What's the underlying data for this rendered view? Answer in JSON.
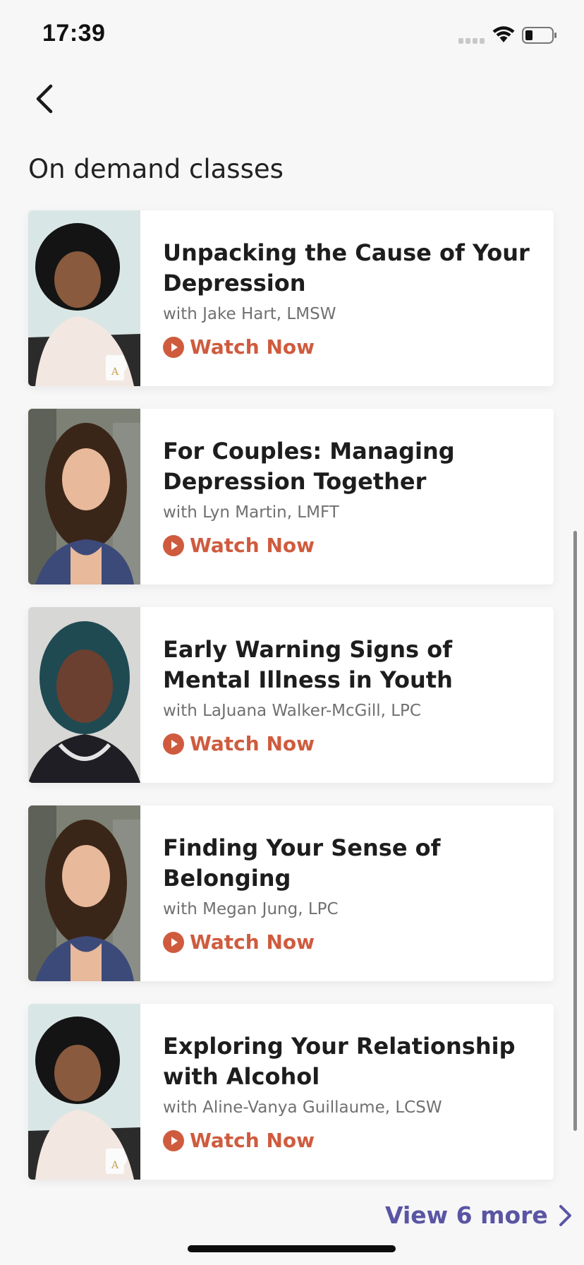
{
  "status_bar": {
    "time": "17:39"
  },
  "header": {
    "section_title": "On demand classes"
  },
  "classes": [
    {
      "title": "Unpacking the Cause of Your Depression",
      "instructor": "with Jake Hart, LMSW",
      "action": "Watch Now",
      "photo": "woman-curly-hair-with-mug"
    },
    {
      "title": "For Couples: Managing Depression Together",
      "instructor": "with Lyn Martin, LMFT",
      "action": "Watch Now",
      "photo": "woman-long-brown-hair"
    },
    {
      "title": "Early Warning Signs of Mental Illness in Youth",
      "instructor": "with LaJuana Walker-McGill, LPC",
      "action": "Watch Now",
      "photo": "woman-teal-bob-hair"
    },
    {
      "title": "Finding Your Sense of Belonging",
      "instructor": "with Megan Jung, LPC",
      "action": "Watch Now",
      "photo": "woman-long-brown-hair"
    },
    {
      "title": "Exploring Your Relationship with Alcohol",
      "instructor": "with Aline-Vanya Guillaume, LCSW",
      "action": "Watch Now",
      "photo": "woman-curly-hair-with-mug"
    }
  ],
  "footer": {
    "view_more_label": "View 6 more"
  },
  "colors": {
    "accent_orange": "#cf5b3e",
    "link_purple": "#5a55a3",
    "background": "#f7f7f7",
    "card": "#ffffff"
  }
}
